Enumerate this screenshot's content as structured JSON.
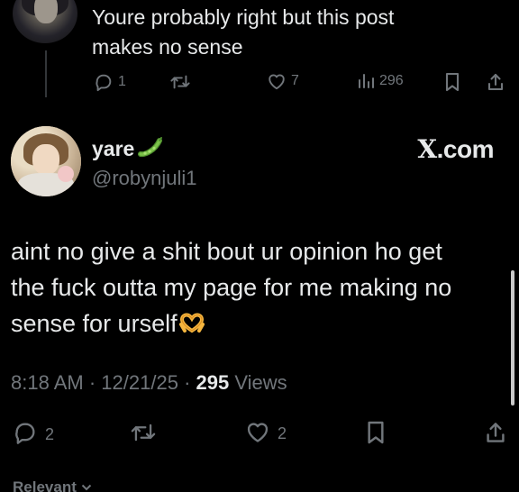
{
  "parent_tweet": {
    "text_line1": "Youre probably right but this post",
    "text_line2": "makes no sense",
    "actions": {
      "replies": "1",
      "likes": "7",
      "views": "296"
    }
  },
  "main_tweet": {
    "display_name": "yare",
    "handle": "@robynjuli1",
    "brand": "X.com",
    "text_line1": "aint no give a shit bout ur opinion ho get",
    "text_line2": "the fuck outta my page for me making no",
    "text_line3": "sense for urself",
    "time": "8:18 AM",
    "date": "12/21/25",
    "views": "295",
    "views_label": "Views",
    "separator": "·",
    "actions": {
      "replies": "2",
      "likes": "2"
    }
  },
  "footer": {
    "relevant_label": "Relevant"
  },
  "colors": {
    "background": "#000000",
    "text": "#e7e9ea",
    "muted": "#71767b",
    "emoji": "#f5b63f",
    "pea": "#6db33f"
  },
  "icons": [
    "reply-icon",
    "retweet-icon",
    "like-icon",
    "views-icon",
    "bookmark-icon",
    "share-icon",
    "pea-emoji-icon",
    "heart-hands-emoji-icon"
  ]
}
